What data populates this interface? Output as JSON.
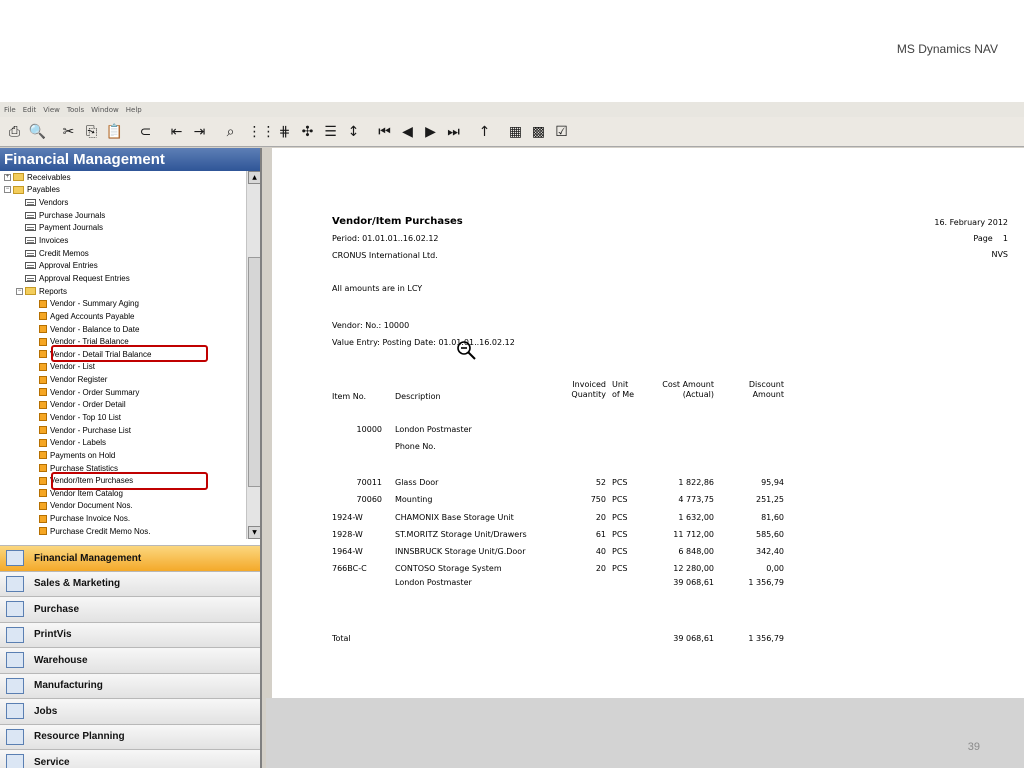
{
  "slide": {
    "title": "MS Dynamics NAV",
    "number": "39"
  },
  "menu": [
    "File",
    "Edit",
    "View",
    "Tools",
    "Window",
    "Help"
  ],
  "sidebar": {
    "title": "Financial Management",
    "tree": [
      {
        "label": "Receivables",
        "kind": "folder",
        "level": 0,
        "expander": "+"
      },
      {
        "label": "Payables",
        "kind": "folder",
        "level": 0,
        "expander": "−"
      },
      {
        "label": "Vendors",
        "kind": "form",
        "level": 1
      },
      {
        "label": "Purchase Journals",
        "kind": "form",
        "level": 1
      },
      {
        "label": "Payment Journals",
        "kind": "form",
        "level": 1
      },
      {
        "label": "Invoices",
        "kind": "form",
        "level": 1
      },
      {
        "label": "Credit Memos",
        "kind": "form",
        "level": 1
      },
      {
        "label": "Approval Entries",
        "kind": "form",
        "level": 1
      },
      {
        "label": "Approval Request Entries",
        "kind": "form",
        "level": 1
      },
      {
        "label": "Reports",
        "kind": "folder",
        "level": 1,
        "expander": "−"
      },
      {
        "label": "Vendor - Summary Aging",
        "kind": "report",
        "level": 2
      },
      {
        "label": "Aged Accounts Payable",
        "kind": "report",
        "level": 2
      },
      {
        "label": "Vendor - Balance to Date",
        "kind": "report",
        "level": 2
      },
      {
        "label": "Vendor - Trial Balance",
        "kind": "report",
        "level": 2
      },
      {
        "label": "Vendor - Detail Trial Balance",
        "kind": "report",
        "level": 2
      },
      {
        "label": "Vendor - List",
        "kind": "report",
        "level": 2
      },
      {
        "label": "Vendor Register",
        "kind": "report",
        "level": 2
      },
      {
        "label": "Vendor - Order Summary",
        "kind": "report",
        "level": 2
      },
      {
        "label": "Vendor - Order Detail",
        "kind": "report",
        "level": 2
      },
      {
        "label": "Vendor - Top 10 List",
        "kind": "report",
        "level": 2
      },
      {
        "label": "Vendor - Purchase List",
        "kind": "report",
        "level": 2
      },
      {
        "label": "Vendor - Labels",
        "kind": "report",
        "level": 2
      },
      {
        "label": "Payments on Hold",
        "kind": "report",
        "level": 2
      },
      {
        "label": "Purchase Statistics",
        "kind": "report",
        "level": 2
      },
      {
        "label": "Vendor/Item Purchases",
        "kind": "report",
        "level": 2
      },
      {
        "label": "Vendor Item Catalog",
        "kind": "report",
        "level": 2
      },
      {
        "label": "Vendor Document Nos.",
        "kind": "report",
        "level": 2
      },
      {
        "label": "Purchase Invoice Nos.",
        "kind": "report",
        "level": 2
      },
      {
        "label": "Purchase Credit Memo Nos.",
        "kind": "report",
        "level": 2
      }
    ],
    "nav_buttons": [
      {
        "label": "Financial Management",
        "active": true
      },
      {
        "label": "Sales & Marketing"
      },
      {
        "label": "Purchase"
      },
      {
        "label": "PrintVis"
      },
      {
        "label": "Warehouse"
      },
      {
        "label": "Manufacturing"
      },
      {
        "label": "Jobs"
      },
      {
        "label": "Resource Planning"
      },
      {
        "label": "Service"
      }
    ]
  },
  "report": {
    "title": "Vendor/Item Purchases",
    "date": "16. February 2012",
    "page_label": "Page",
    "page_number": "1",
    "user": "NVS",
    "period": "Period: 01.01.01..16.02.12",
    "company": "CRONUS International Ltd.",
    "currency_note": "All amounts are in LCY",
    "vendor_filter": "Vendor: No.: 10000",
    "value_entry_filter": "Value Entry: Posting Date: 01.01.01..16.02.12",
    "headers": {
      "item_no": "Item No.",
      "description": "Description",
      "invoiced_1": "Invoiced",
      "invoiced_2": "Quantity",
      "unit_1": "Unit",
      "unit_2": "of Me",
      "cost_1": "Cost Amount",
      "cost_2": "(Actual)",
      "discount_1": "Discount",
      "discount_2": "Amount"
    },
    "vendor_no": "10000",
    "vendor_name": "London Postmaster",
    "phone_label": "Phone No.",
    "rows": [
      {
        "item_no": "70011",
        "description": "Glass Door",
        "quantity": "52",
        "unit": "PCS",
        "cost": "1 822,86",
        "discount": "95,94"
      },
      {
        "item_no": "70060",
        "description": "Mounting",
        "quantity": "750",
        "unit": "PCS",
        "cost": "4 773,75",
        "discount": "251,25"
      },
      {
        "item_no": "1924-W",
        "description": "CHAMONIX Base Storage Unit",
        "quantity": "20",
        "unit": "PCS",
        "cost": "1 632,00",
        "discount": "81,60"
      },
      {
        "item_no": "1928-W",
        "description": "ST.MORITZ Storage Unit/Drawers",
        "quantity": "61",
        "unit": "PCS",
        "cost": "11 712,00",
        "discount": "585,60"
      },
      {
        "item_no": "1964-W",
        "description": "INNSBRUCK Storage Unit/G.Door",
        "quantity": "40",
        "unit": "PCS",
        "cost": "6 848,00",
        "discount": "342,40"
      },
      {
        "item_no": "766BC-C",
        "description": "CONTOSO Storage System",
        "quantity": "20",
        "unit": "PCS",
        "cost": "12 280,00",
        "discount": "0,00"
      }
    ],
    "subtotal": {
      "label": "London Postmaster",
      "cost": "39 068,61",
      "discount": "1 356,79"
    },
    "total": {
      "label": "Total",
      "cost": "39 068,61",
      "discount": "1 356,79"
    }
  }
}
